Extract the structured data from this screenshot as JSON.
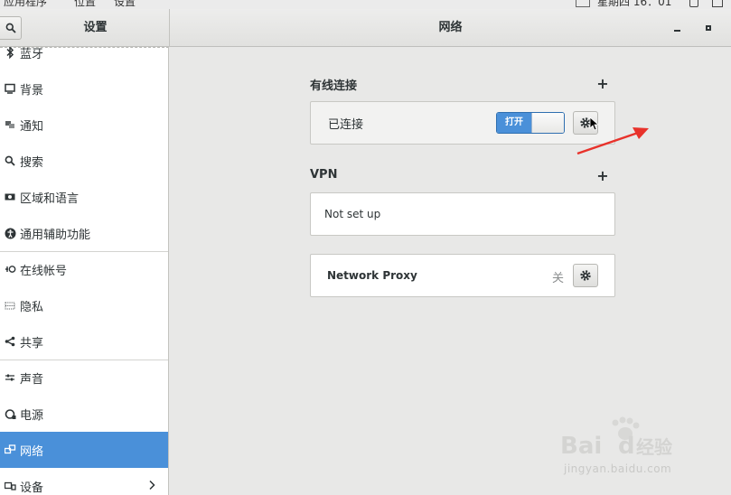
{
  "topbar": {
    "apps": "应用程序",
    "places": "位置",
    "settings": "设置",
    "clock": "星期四 16：01"
  },
  "header": {
    "left_title": "设置",
    "main_title": "网络"
  },
  "sidebar": {
    "items": [
      {
        "label": "蓝牙",
        "icon": "bluetooth-icon"
      },
      {
        "label": "背景",
        "icon": "display-icon"
      },
      {
        "label": "通知",
        "icon": "notification-icon"
      },
      {
        "label": "搜索",
        "icon": "search-icon"
      },
      {
        "label": "区域和语言",
        "icon": "region-icon"
      },
      {
        "label": "通用辅助功能",
        "icon": "accessibility-icon"
      },
      {
        "label": "在线帐号",
        "icon": "online-accounts-icon"
      },
      {
        "label": "隐私",
        "icon": "privacy-icon"
      },
      {
        "label": "共享",
        "icon": "share-icon"
      },
      {
        "label": "声音",
        "icon": "sound-icon"
      },
      {
        "label": "电源",
        "icon": "power-icon"
      },
      {
        "label": "网络",
        "icon": "network-icon",
        "active": true
      },
      {
        "label": "设备",
        "icon": "devices-icon"
      }
    ]
  },
  "wired": {
    "title": "有线连接",
    "status": "已连接",
    "toggle_on_label": "打开"
  },
  "vpn": {
    "title": "VPN",
    "status": "Not set up"
  },
  "proxy": {
    "title": "Network Proxy",
    "state": "关"
  },
  "watermark": {
    "url": "jingyan.baidu.com",
    "brand": "Baidu经验"
  },
  "colors": {
    "accent": "#4a90d9",
    "annotation": "#e8322b"
  }
}
